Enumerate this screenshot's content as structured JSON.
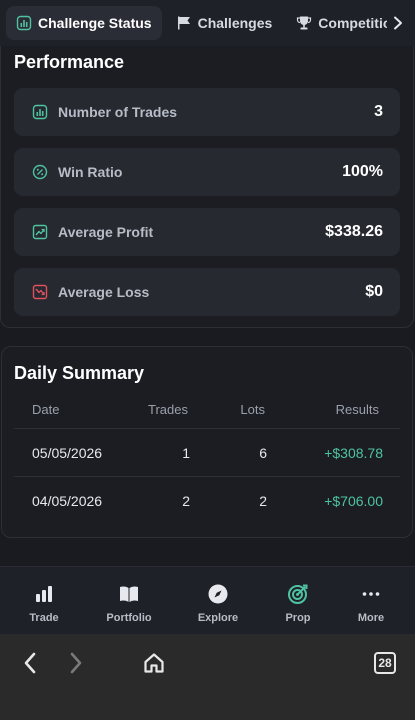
{
  "tabs": [
    {
      "label": "Challenge Status",
      "icon": "bar-chart-icon",
      "active": true
    },
    {
      "label": "Challenges",
      "icon": "flag-icon",
      "active": false
    },
    {
      "label": "Competitions",
      "icon": "trophy-icon",
      "active": false
    }
  ],
  "performance": {
    "title": "Performance",
    "stats": [
      {
        "label": "Number of Trades",
        "value": "3",
        "icon": "bar-chart-icon",
        "color": "#4fc3a1"
      },
      {
        "label": "Win Ratio",
        "value": "100%",
        "icon": "percent-icon",
        "color": "#4fc3a1"
      },
      {
        "label": "Average Profit",
        "value": "$338.26",
        "icon": "trend-up-icon",
        "color": "#4fc3a1"
      },
      {
        "label": "Average Loss",
        "value": "$0",
        "icon": "trend-down-icon",
        "color": "#e0505e"
      }
    ]
  },
  "daily_summary": {
    "title": "Daily Summary",
    "columns": [
      "Date",
      "Trades",
      "Lots",
      "Results"
    ],
    "rows": [
      {
        "date": "05/05/2026",
        "trades": "1",
        "lots": "6",
        "result": "+$308.78"
      },
      {
        "date": "04/05/2026",
        "trades": "2",
        "lots": "2",
        "result": "+$706.00"
      }
    ]
  },
  "bottom_nav": [
    {
      "label": "Trade",
      "icon": "bar-chart-icon"
    },
    {
      "label": "Portfolio",
      "icon": "book-icon"
    },
    {
      "label": "Explore",
      "icon": "compass-icon"
    },
    {
      "label": "Prop",
      "icon": "target-icon"
    },
    {
      "label": "More",
      "icon": "more-icon"
    }
  ],
  "browser": {
    "tab_count": "28"
  },
  "colors": {
    "accent": "#4fc3a1",
    "negative": "#e0505e",
    "background": "#191b21",
    "card": "#262930"
  }
}
